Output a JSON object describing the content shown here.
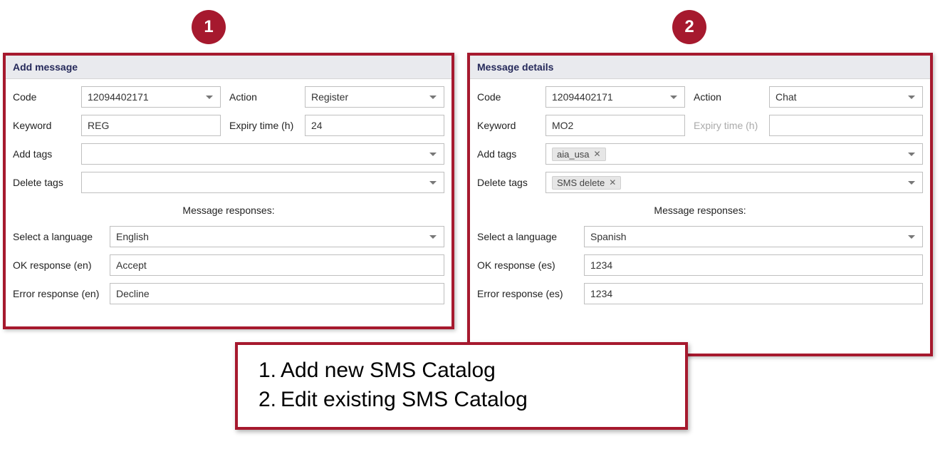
{
  "badges": {
    "one": "1",
    "two": "2"
  },
  "panelLeft": {
    "header": "Add message",
    "codeLabel": "Code",
    "codeValue": "12094402171",
    "actionLabel": "Action",
    "actionValue": "Register",
    "keywordLabel": "Keyword",
    "keywordValue": "REG",
    "expiryLabel": "Expiry time (h)",
    "expiryValue": "24",
    "addTagsLabel": "Add tags",
    "deleteTagsLabel": "Delete tags",
    "responsesTitle": "Message responses:",
    "langLabel": "Select a language",
    "langValue": "English",
    "okLabel": "OK response (en)",
    "okValue": "Accept",
    "errLabel": "Error response (en)",
    "errValue": "Decline"
  },
  "panelRight": {
    "header": "Message details",
    "codeLabel": "Code",
    "codeValue": "12094402171",
    "actionLabel": "Action",
    "actionValue": "Chat",
    "keywordLabel": "Keyword",
    "keywordValue": "MO2",
    "expiryLabel": "Expiry time (h)",
    "expiryValue": "",
    "addTagsLabel": "Add tags",
    "addTagChip": "aia_usa",
    "deleteTagsLabel": "Delete tags",
    "deleteTagChip": "SMS delete",
    "responsesTitle": "Message responses:",
    "langLabel": "Select a language",
    "langValue": "Spanish",
    "okLabel": "OK response (es)",
    "okValue": "1234",
    "errLabel": "Error response (es)",
    "errValue": "1234"
  },
  "caption": {
    "n1": "1.",
    "t1": "Add new SMS Catalog",
    "n2": "2.",
    "t2": "Edit existing SMS Catalog"
  }
}
